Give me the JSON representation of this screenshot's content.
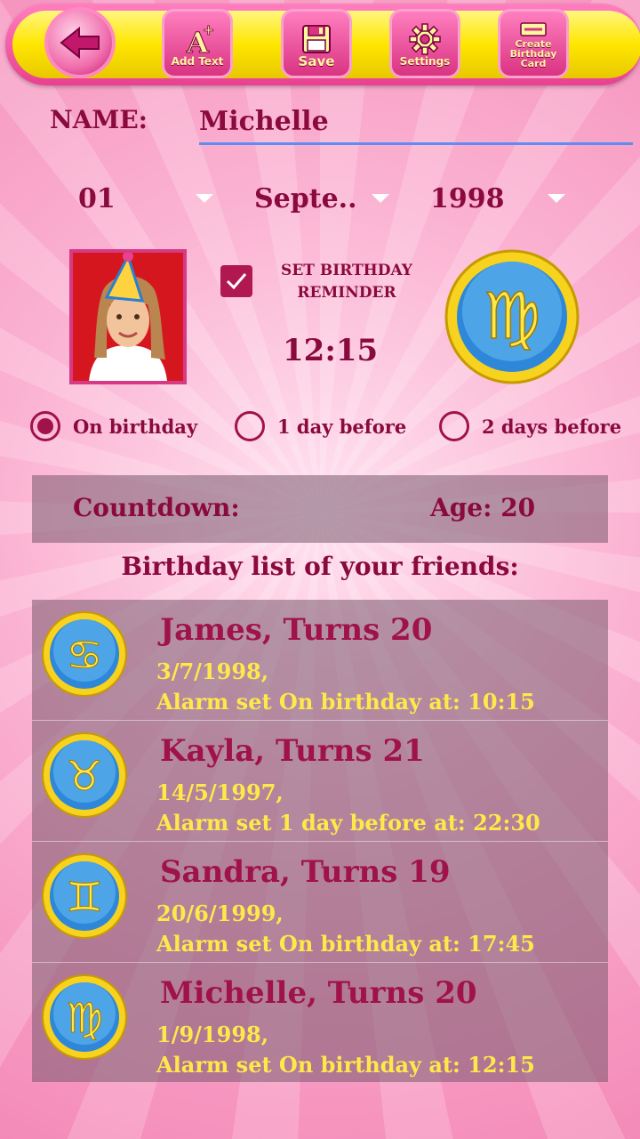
{
  "toolbar": {
    "back_icon": "arrow-left-icon",
    "buttons": [
      {
        "label": "Add Text",
        "icon": "add-text-icon"
      },
      {
        "label": "Save",
        "icon": "floppy-disk-icon"
      },
      {
        "label": "Settings",
        "icon": "gear-icon"
      },
      {
        "label": "Create Birthday Card",
        "icon": "pencil-card-icon"
      }
    ]
  },
  "form": {
    "name_label": "NAME:",
    "name_value": "Michelle",
    "day": "01",
    "month": "Septe..",
    "year": "1998",
    "reminder_checked": true,
    "reminder_label": "SET BIRTHDAY REMINDER",
    "time": "12:15",
    "zodiac_sign": "virgo-icon",
    "radio_options": [
      {
        "label": "On birthday",
        "selected": true
      },
      {
        "label": "1 day before",
        "selected": false
      },
      {
        "label": "2 days before",
        "selected": false
      }
    ]
  },
  "countdown": {
    "label": "Countdown:",
    "age": "Age: 20"
  },
  "list": {
    "title": "Birthday list of your friends:",
    "items": [
      {
        "name": "James, Turns 20",
        "date": "3/7/1998,",
        "alarm": "Alarm set On birthday at: 10:15",
        "sign": "cancer-icon",
        "glyph": "♋"
      },
      {
        "name": "Kayla, Turns 21",
        "date": "14/5/1997,",
        "alarm": "Alarm set 1 day before at: 22:30",
        "sign": "taurus-icon",
        "glyph": "♉"
      },
      {
        "name": "Sandra, Turns 19",
        "date": "20/6/1999,",
        "alarm": "Alarm set On birthday at: 17:45",
        "sign": "gemini-icon",
        "glyph": "♊"
      },
      {
        "name": "Michelle, Turns 20",
        "date": "1/9/1998,",
        "alarm": "Alarm set On birthday at: 12:15",
        "sign": "virgo-icon",
        "glyph": "♍"
      }
    ]
  },
  "colors": {
    "accent": "#8a0a3e",
    "highlight": "#ffe84a",
    "toolbar_yellow": "#ffe600",
    "toolbar_pink": "#e8418f"
  }
}
